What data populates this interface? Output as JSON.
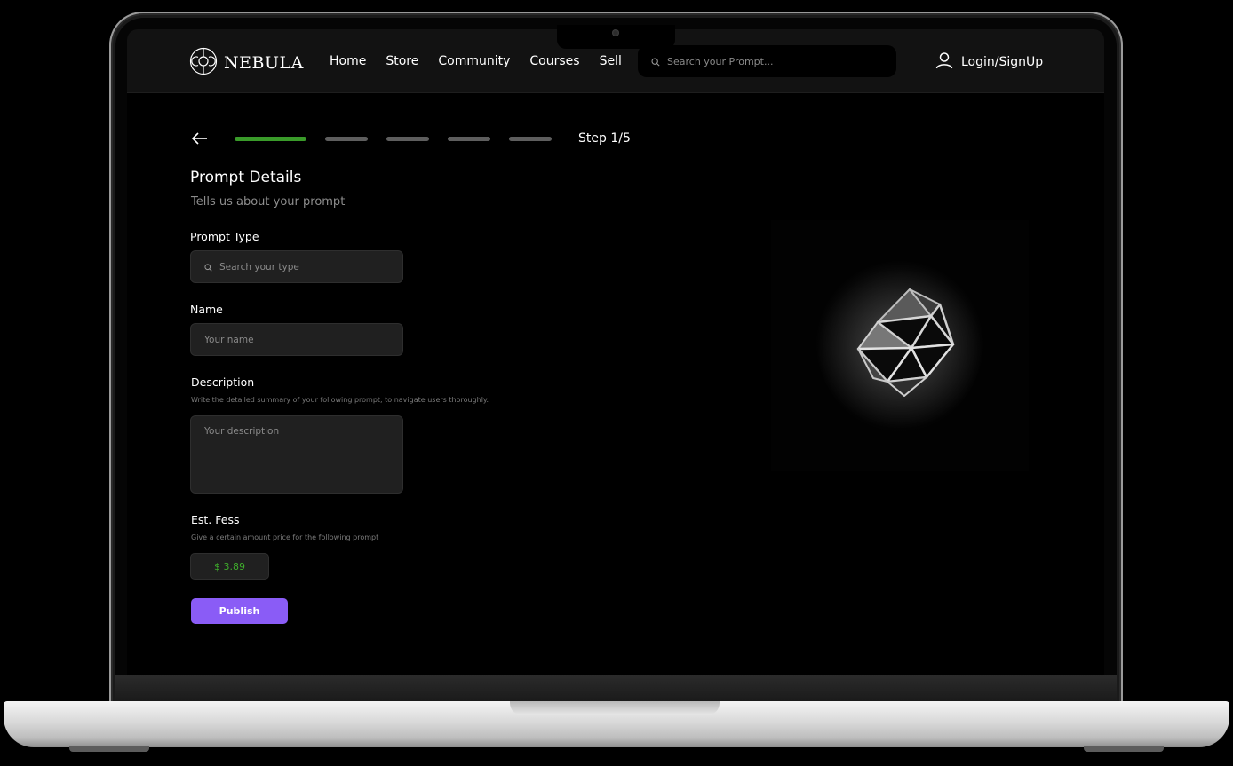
{
  "brand": {
    "name": "NEBULA"
  },
  "nav": {
    "items": [
      "Home",
      "Store",
      "Community",
      "Courses",
      "Sell"
    ]
  },
  "search": {
    "placeholder": "Search your Prompt..."
  },
  "auth": {
    "label": "Login/SignUp"
  },
  "progress": {
    "label": "Step 1/5",
    "current_step": 1,
    "total_steps": 5
  },
  "form": {
    "title": "Prompt Details",
    "subtitle": "Tells us about your prompt",
    "prompt_type": {
      "label": "Prompt Type",
      "placeholder": "Search your type"
    },
    "name": {
      "label": "Name",
      "placeholder": "Your name"
    },
    "description": {
      "label": "Description",
      "hint": "Write the detailed summary of your following prompt, to navigate users thoroughly.",
      "placeholder": "Your description"
    },
    "fees": {
      "label": "Est. Fess",
      "hint": "Give a certain amount price for the following prompt",
      "value": "$ 3.89"
    },
    "publish_label": "Publish"
  },
  "colors": {
    "accent": "#8a5cf6",
    "progress_active": "#3a9b2a",
    "progress_inactive": "#5e5e5e",
    "price_text": "#3fae2c",
    "header_bg": "#121212",
    "field_bg": "#202020"
  },
  "icons": {
    "logo": "nebula-logo-icon",
    "search": "search-icon",
    "user": "user-icon",
    "back": "arrow-left-icon",
    "artwork": "icosahedron-illustration"
  }
}
